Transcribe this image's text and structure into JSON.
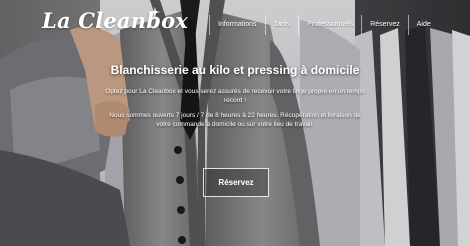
{
  "brand": {
    "name": "La Cleanbox",
    "mark_icon": "sparkle-icon"
  },
  "nav": {
    "items": [
      {
        "label": "Informations"
      },
      {
        "label": "Tarifs"
      },
      {
        "label": "Professionnels"
      },
      {
        "label": "Réservez"
      },
      {
        "label": "Aide"
      }
    ]
  },
  "hero": {
    "headline": "Blanchisserie au kilo et pressing à domicile",
    "paragraph_1": "Optez pour La Cleanbox et vous serez assurés de recevoir votre linge propre en un temps record !",
    "paragraph_2": "Nous sommes ouverts 7 jours / 7 de 8 heures à 22 heures. Récupération et livraison de votre commande à domicile ou sur votre lieu de travail.",
    "cta_label": "Réservez"
  },
  "colors": {
    "text": "#ffffff",
    "background": "#4a4a4a",
    "vest": "#8a8a8a"
  }
}
